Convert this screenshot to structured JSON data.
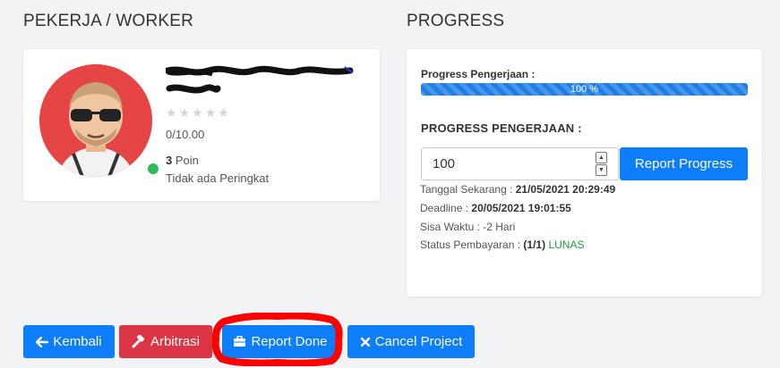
{
  "worker_section": {
    "title": "PEKERJA / WORKER",
    "stars": [
      "★",
      "★",
      "★",
      "★",
      "★"
    ],
    "rating": "0/10.00",
    "points_value": "3",
    "points_label": "Poin",
    "rank": "Tidak ada Peringkat",
    "online_color": "#2ebd59",
    "avatar_bg": "#e54545"
  },
  "progress_section": {
    "title": "PROGRESS",
    "bar_label": "Progress Pengerjaan :",
    "bar_value": 1.0,
    "bar_text": "100 %",
    "heading": "PROGRESS PENGERJAAN :",
    "input_value": "100",
    "report_button": "Report Progress",
    "current_date_label": "Tanggal Sekarang :",
    "current_date": "21/05/2021 20:29:49",
    "deadline_label": "Deadline :",
    "deadline": "20/05/2021 19:01:55",
    "remaining_label": "Sisa Waktu : -2 Hari",
    "payment_label": "Status Pembayaran :",
    "payment_count": "(1/1)",
    "payment_status": "LUNAS"
  },
  "actions": {
    "kembali": "Kembali",
    "arbitrasi": "Arbitrasi",
    "report_done": "Report Done",
    "cancel_project": "Cancel Project"
  },
  "colors": {
    "primary": "#0d7dfa",
    "danger": "#dc3545",
    "success": "#1f9b3c",
    "annotation": "#ff0000"
  }
}
